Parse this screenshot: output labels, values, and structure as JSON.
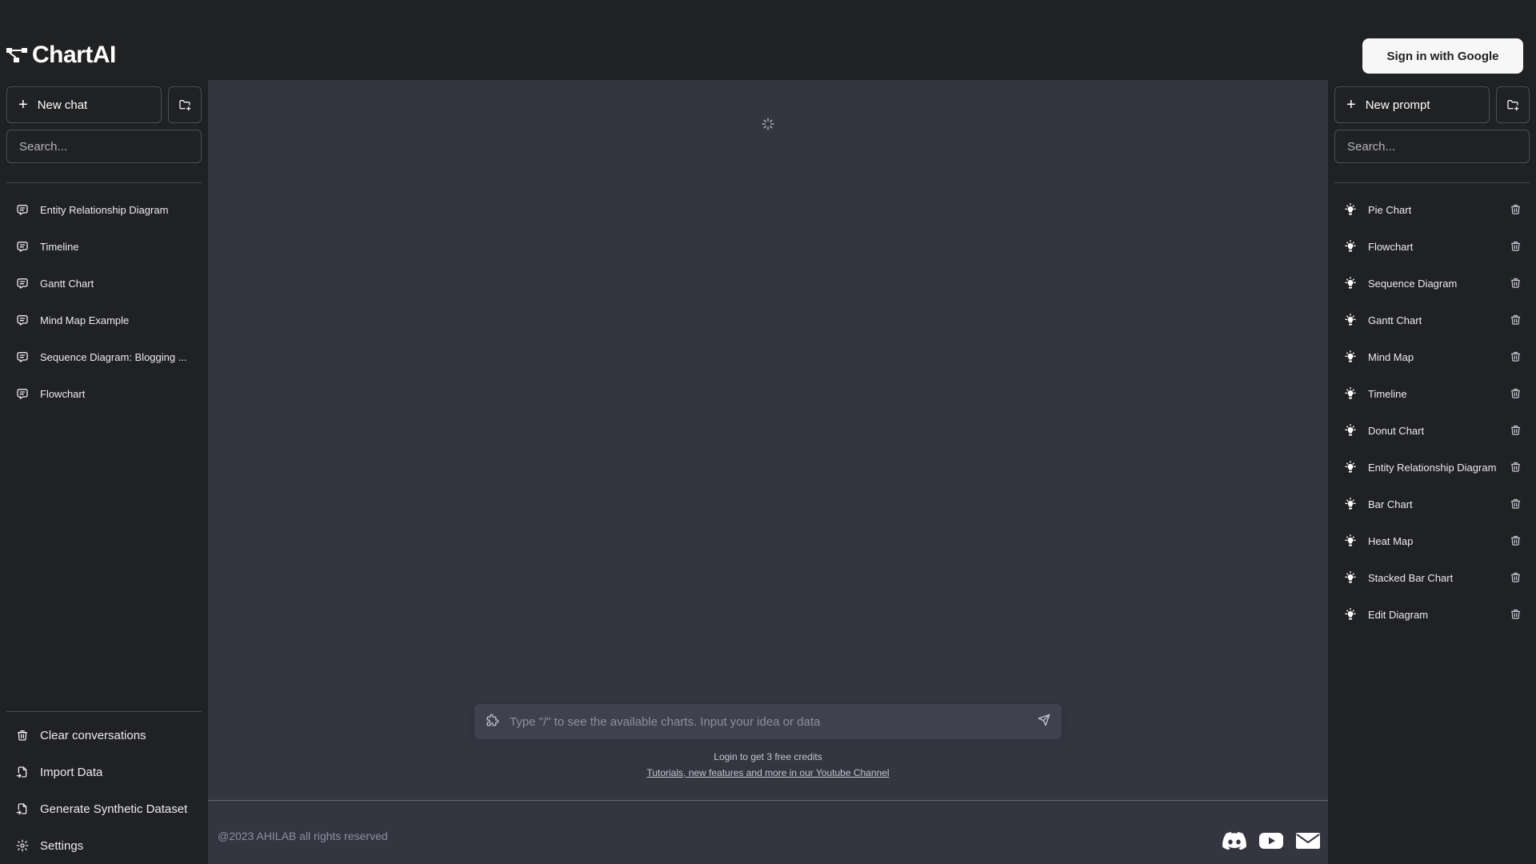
{
  "app": {
    "title": "ChartAI"
  },
  "header": {
    "signin_label": "Sign in with Google"
  },
  "left_sidebar": {
    "new_chat_label": "New chat",
    "search_placeholder": "Search...",
    "conversations": [
      {
        "label": "Entity Relationship Diagram"
      },
      {
        "label": "Timeline"
      },
      {
        "label": "Gantt Chart"
      },
      {
        "label": "Mind Map Example"
      },
      {
        "label": "Sequence Diagram: Blogging ..."
      },
      {
        "label": "Flowchart"
      }
    ],
    "bottom_items": [
      {
        "label": "Clear conversations",
        "icon": "trash-icon"
      },
      {
        "label": "Import Data",
        "icon": "file-import-icon"
      },
      {
        "label": "Generate Synthetic Dataset",
        "icon": "file-import-icon"
      },
      {
        "label": "Settings",
        "icon": "gear-icon"
      }
    ]
  },
  "right_sidebar": {
    "new_prompt_label": "New prompt",
    "search_placeholder": "Search...",
    "prompts": [
      {
        "label": "Pie Chart"
      },
      {
        "label": "Flowchart"
      },
      {
        "label": "Sequence Diagram"
      },
      {
        "label": "Gantt Chart"
      },
      {
        "label": "Mind Map"
      },
      {
        "label": "Timeline"
      },
      {
        "label": "Donut Chart"
      },
      {
        "label": "Entity Relationship Diagram"
      },
      {
        "label": "Bar Chart"
      },
      {
        "label": "Heat Map"
      },
      {
        "label": "Stacked Bar Chart"
      },
      {
        "label": "Edit Diagram"
      }
    ]
  },
  "main": {
    "composer_placeholder": "Type \"/\" to see the available charts. Input your idea or data",
    "credits_hint": "Login to get 3 free credits",
    "tutorial_link": "Tutorials, new features and more in our Youtube Channel",
    "copyright": "@2023 AHILAB all rights reserved"
  },
  "colors": {
    "sidebar_bg": "#202123",
    "main_bg": "#343541",
    "composer_bg": "#40414f",
    "signin_bg": "#f7f7f8"
  }
}
